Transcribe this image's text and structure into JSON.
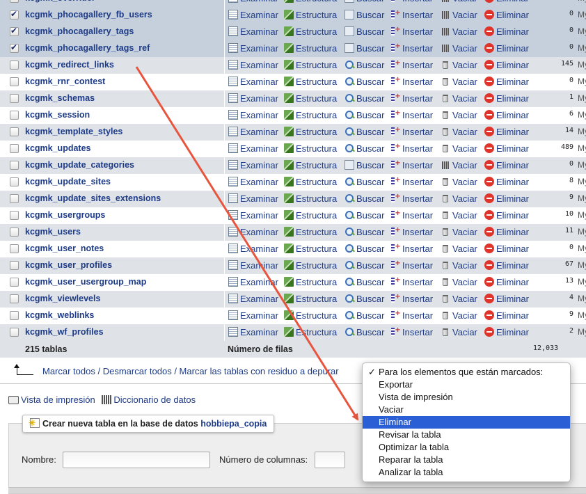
{
  "actions": {
    "browse": "Examinar",
    "structure": "Estructura",
    "search": "Buscar",
    "insert": "Insertar",
    "empty": "Vaciar",
    "drop": "Eliminar"
  },
  "size_unit": "MyISAM",
  "tables": [
    {
      "name": "kcgmk_overrider",
      "rows": "",
      "checked": true,
      "clipped": true
    },
    {
      "name": "kcgmk_phocagallery_fb_users",
      "rows": "0",
      "checked": true
    },
    {
      "name": "kcgmk_phocagallery_tags",
      "rows": "0",
      "checked": true
    },
    {
      "name": "kcgmk_phocagallery_tags_ref",
      "rows": "0",
      "checked": true
    },
    {
      "name": "kcgmk_redirect_links",
      "rows": "145",
      "checked": false
    },
    {
      "name": "kcgmk_rnr_contest",
      "rows": "0",
      "checked": false
    },
    {
      "name": "kcgmk_schemas",
      "rows": "1",
      "checked": false
    },
    {
      "name": "kcgmk_session",
      "rows": "6",
      "checked": false
    },
    {
      "name": "kcgmk_template_styles",
      "rows": "14",
      "checked": false
    },
    {
      "name": "kcgmk_updates",
      "rows": "489",
      "checked": false
    },
    {
      "name": "kcgmk_update_categories",
      "rows": "0",
      "checked": false
    },
    {
      "name": "kcgmk_update_sites",
      "rows": "8",
      "checked": false
    },
    {
      "name": "kcgmk_update_sites_extensions",
      "rows": "9",
      "checked": false
    },
    {
      "name": "kcgmk_usergroups",
      "rows": "10",
      "checked": false
    },
    {
      "name": "kcgmk_users",
      "rows": "11",
      "checked": false
    },
    {
      "name": "kcgmk_user_notes",
      "rows": "0",
      "checked": false
    },
    {
      "name": "kcgmk_user_profiles",
      "rows": "67",
      "checked": false
    },
    {
      "name": "kcgmk_user_usergroup_map",
      "rows": "13",
      "checked": false
    },
    {
      "name": "kcgmk_viewlevels",
      "rows": "4",
      "checked": false
    },
    {
      "name": "kcgmk_weblinks",
      "rows": "9",
      "checked": false
    },
    {
      "name": "kcgmk_wf_profiles",
      "rows": "2",
      "checked": false
    }
  ],
  "footer": {
    "table_count": "215 tablas",
    "rows_label": "Número de filas",
    "rows_total": "12,033"
  },
  "selection": {
    "mark_all": "Marcar todos",
    "unmark_all": "Desmarcar todos",
    "mark_overhead": "Marcar las tablas con residuo a depurar",
    "separator": " / "
  },
  "links": {
    "print_view": "Vista de impresión",
    "data_dictionary": "Diccionario de datos"
  },
  "create": {
    "legend": "Crear nueva tabla en la base de datos",
    "database": "hobbiepa_copia",
    "name_label": "Nombre:",
    "columns_label": "Número de columnas:",
    "name_value": "",
    "columns_value": ""
  },
  "dropdown": {
    "items": [
      {
        "label": "Para los elementos que están marcados:",
        "selected": true
      },
      {
        "label": "Exportar"
      },
      {
        "label": "Vista de impresión"
      },
      {
        "label": "Vaciar"
      },
      {
        "label": "Eliminar",
        "highlighted": true
      },
      {
        "label": "Revisar la tabla"
      },
      {
        "label": "Optimizar la tabla"
      },
      {
        "label": "Reparar la tabla"
      },
      {
        "label": "Analizar la tabla"
      }
    ]
  },
  "colors": {
    "link": "#1d3b87",
    "row_alt": "#dfe3e8",
    "row_checked": "#c6d0dd",
    "menu_highlight": "#2a5fd6",
    "annotation_arrow": "#e8553f"
  }
}
